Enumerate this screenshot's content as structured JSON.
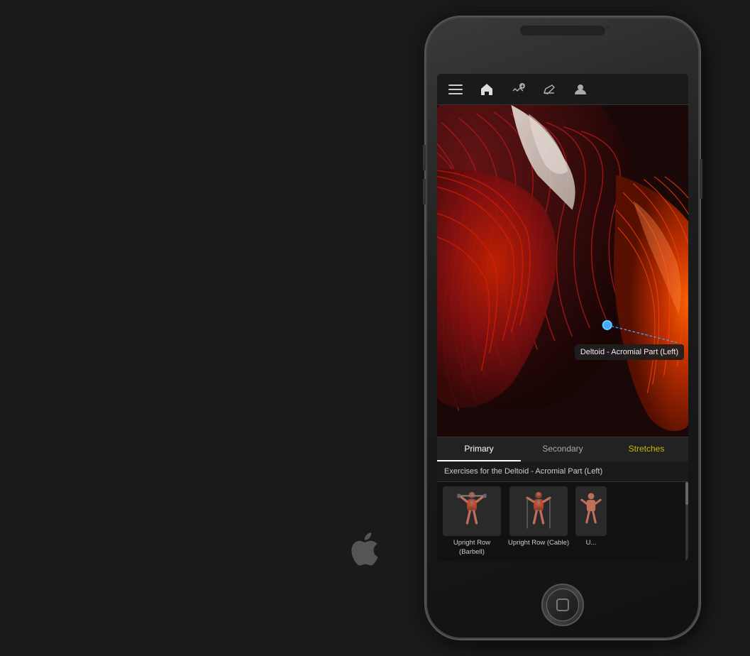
{
  "scene": {
    "background_color": "#1a1a1a"
  },
  "phone": {
    "toolbar": {
      "buttons": [
        {
          "id": "menu",
          "icon": "≡",
          "label": "Menu",
          "active": false
        },
        {
          "id": "home",
          "icon": "⌂",
          "label": "Home",
          "active": true
        },
        {
          "id": "add",
          "icon": "✎+",
          "label": "Add",
          "active": false
        },
        {
          "id": "edit",
          "icon": "✎",
          "label": "Edit",
          "active": false
        },
        {
          "id": "profile",
          "icon": "👤",
          "label": "Profile",
          "active": false
        }
      ]
    },
    "annotation": {
      "label": "Deltoid - Acromial Part (Left)"
    },
    "tabs": [
      {
        "id": "primary",
        "label": "Primary",
        "active": true
      },
      {
        "id": "secondary",
        "label": "Secondary",
        "active": false
      },
      {
        "id": "stretches",
        "label": "Stretches",
        "active": false
      }
    ],
    "exercise_section": {
      "header": "Exercises for the Deltoid - Acromial Part (Left)",
      "items": [
        {
          "id": "ex1",
          "label": "Upright Row (Barbell)"
        },
        {
          "id": "ex2",
          "label": "Upright Row (Cable)"
        },
        {
          "id": "ex3",
          "label": "U..."
        }
      ]
    }
  }
}
